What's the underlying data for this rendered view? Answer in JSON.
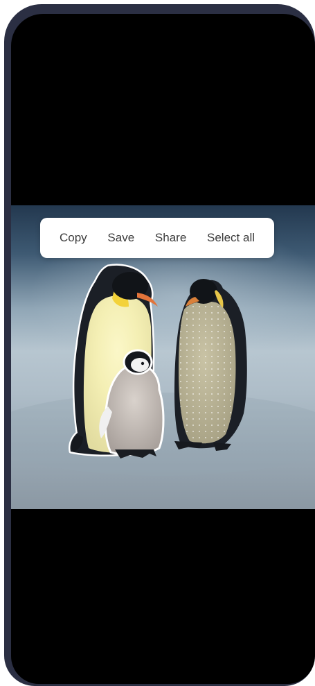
{
  "context_menu": {
    "items": [
      {
        "label": "Copy"
      },
      {
        "label": "Save"
      },
      {
        "label": "Share"
      },
      {
        "label": "Select all"
      }
    ]
  },
  "photo": {
    "subject": "emperor-penguins",
    "selection_state": "left-penguin-and-chick-selected"
  },
  "colors": {
    "frame": "#2b2f43",
    "screen": "#000000",
    "menu_bg": "#ffffff",
    "menu_text": "#3b3b3b"
  }
}
